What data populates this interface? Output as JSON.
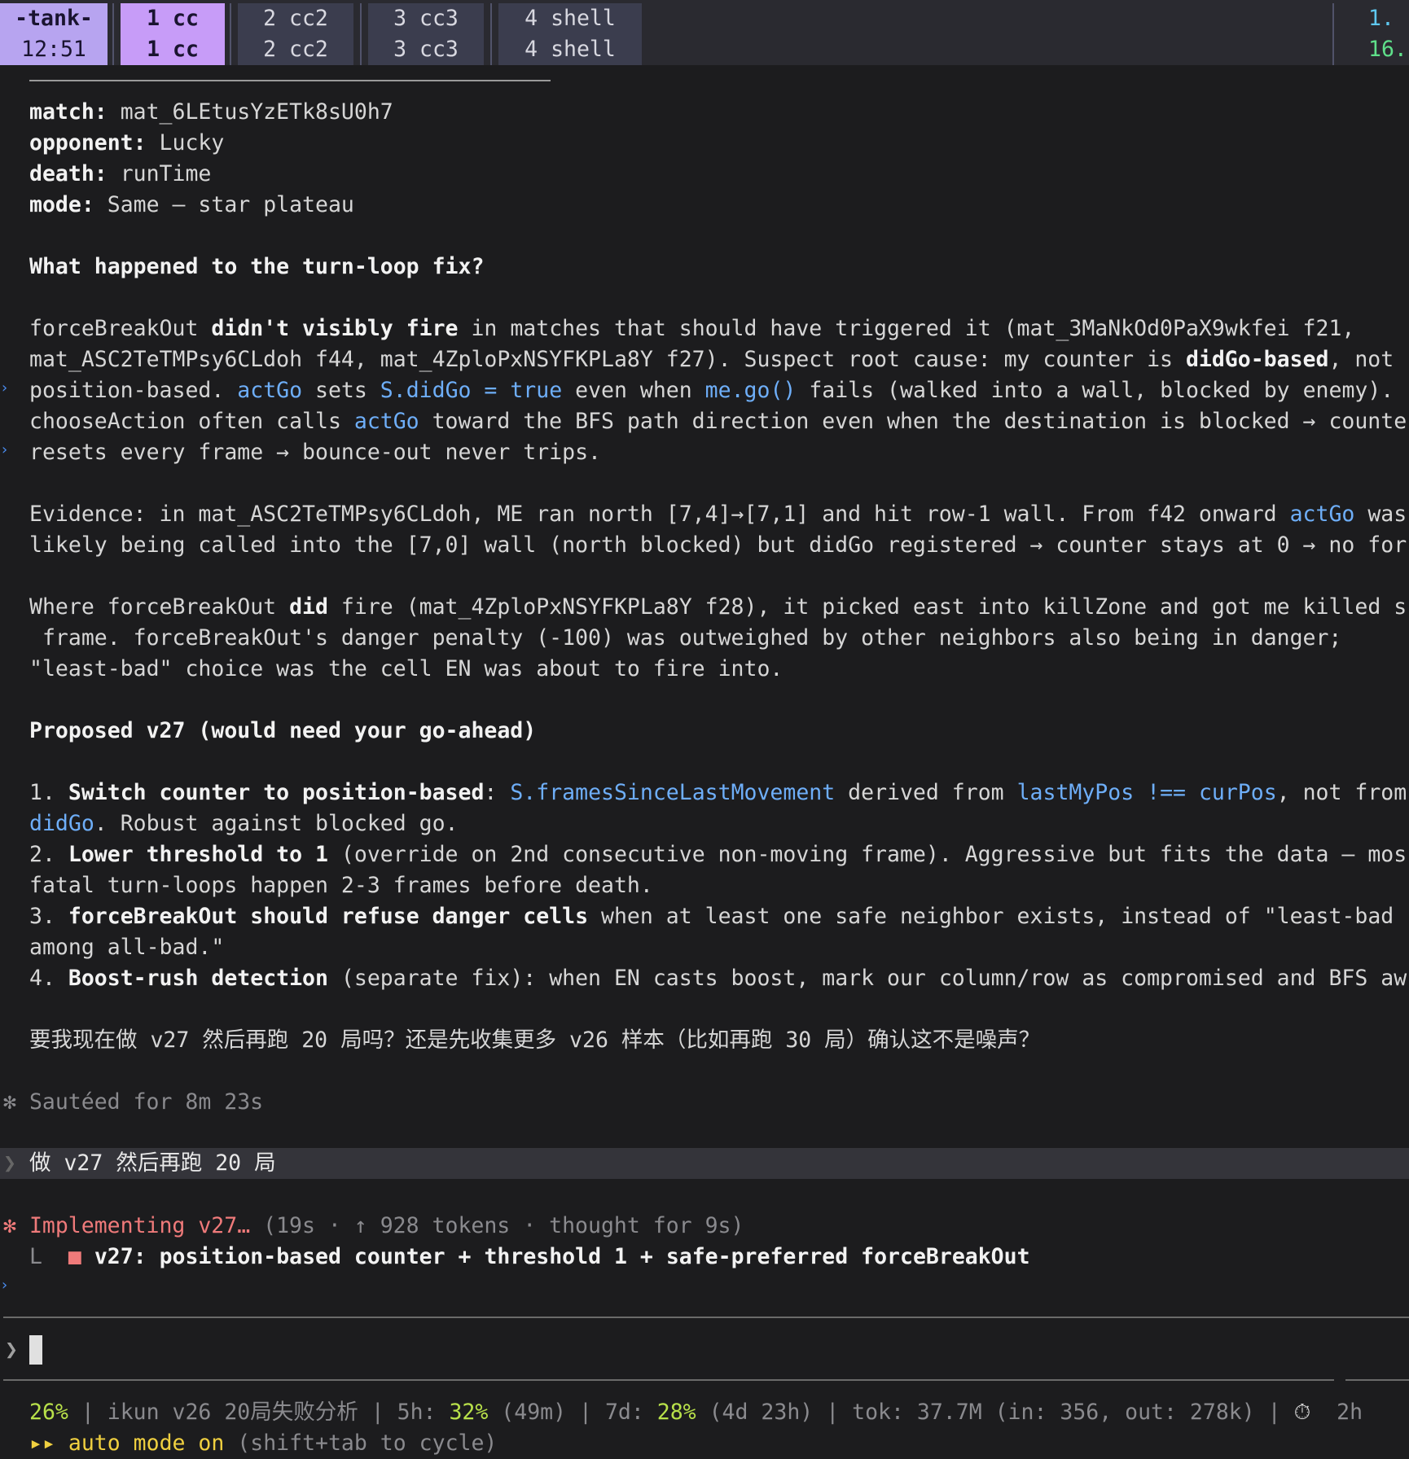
{
  "tabbar": {
    "session": {
      "name": "-tank-",
      "time": "12:51"
    },
    "tabs": [
      {
        "top": "1 cc",
        "bottom": "1 cc",
        "active": true
      },
      {
        "top": "2 cc2",
        "bottom": "2 cc2",
        "active": false
      },
      {
        "top": "3 cc3",
        "bottom": "3 cc3",
        "active": false
      },
      {
        "top": "4 shell",
        "bottom": "4 shell",
        "active": false
      }
    ],
    "right": {
      "top": "1.",
      "bottom": "16."
    }
  },
  "meta": {
    "match_label": "match:",
    "match_value": " mat_6LEtusYzETk8sU0h7",
    "opponent_label": "opponent:",
    "opponent_value": " Lucky",
    "death_label": "death:",
    "death_value": " runTime",
    "mode_label": "mode:",
    "mode_value": " Same — star plateau"
  },
  "section1": {
    "heading": "What happened to the turn-loop fix?",
    "p1": [
      [
        "forceBreakOut ",
        "b:didn't visibly fire",
        " in matches that should have triggered it (mat_3MaNkOd0PaX9wkfei f21,"
      ],
      [
        "mat_ASC2TeTMPsy6CLdoh f44, mat_4ZploPxNSYFKPLa8Y f27). Suspect root cause: my counter is ",
        "b:didGo-based",
        ", not"
      ],
      [
        "position-based. ",
        "c:actGo",
        " sets ",
        "c:S.didGo = true",
        " even when ",
        "c:me.go()",
        " fails (walked into a wall, blocked by enemy)."
      ],
      [
        "chooseAction often calls ",
        "c:actGo",
        " toward the BFS path direction even when the destination is blocked → counte"
      ],
      [
        "resets every frame → bounce-out never trips."
      ]
    ],
    "p2": [
      [
        "Evidence: in mat_ASC2TeTMPsy6CLdoh, ME ran north [7,4]→[7,1] and hit row-1 wall. From f42 onward ",
        "c:actGo",
        " was"
      ],
      [
        "likely being called into the [7,0] wall (north blocked) but didGo registered → counter stays at 0 → no for"
      ]
    ],
    "p3": [
      [
        "Where forceBreakOut ",
        "b:did",
        " fire (mat_4ZploPxNSYFKPLa8Y f28), it picked east into killZone and got me killed s"
      ],
      [
        " frame. forceBreakOut's danger penalty (-100) was outweighed by other neighbors also being in danger;"
      ],
      [
        "\"least-bad\" choice was the cell EN was about to fire into."
      ]
    ]
  },
  "section2": {
    "heading": "Proposed v27 (would need your go-ahead)",
    "items": [
      [
        "1. ",
        "b:Switch counter to position-based",
        ": ",
        "c:S.framesSinceLastMovement",
        " derived from ",
        "c:lastMyPos !== curPos",
        ", not from"
      ],
      [
        "c:didGo",
        ". Robust against blocked go."
      ],
      [
        "2. ",
        "b:Lower threshold to 1",
        " (override on 2nd consecutive non-moving frame). Aggressive but fits the data — mos"
      ],
      [
        "fatal turn-loops happen 2-3 frames before death."
      ],
      [
        "3. ",
        "b:forceBreakOut should refuse danger cells",
        " when at least one safe neighbor exists, instead of \"least-bad"
      ],
      [
        "among all-bad.\""
      ],
      [
        "4. ",
        "b:Boost-rush detection",
        " (separate fix): when EN casts boost, mark our column/row as compromised and BFS aw"
      ]
    ]
  },
  "question": "要我现在做 v27 然后再跑 20 局吗？还是先收集更多 v26 样本（比如再跑 30 局）确认这不是噪声？",
  "sauteed": {
    "star": "✻",
    "text": "Sautéed for 8m 23s"
  },
  "user_message": {
    "chevron": "❯",
    "text": "做 v27 然后再跑 20 局"
  },
  "working": {
    "star": "✻",
    "label": "Implementing v27…",
    "detail": " (19s · ↑ 928 tokens · thought for 9s)",
    "todo_prefix": "L",
    "todo_box": "■",
    "todo_text": "v27: position-based counter + threshold 1 + safe-preferred forceBreakOut"
  },
  "input": {
    "chevron": "❯",
    "value": ""
  },
  "statusline": {
    "pct": "26%",
    "sep": " | ",
    "project": "ikun v26 20局失败分析",
    "h5_label": "5h: ",
    "h5_pct": "32%",
    "h5_rest": " (49m)",
    "d7_label": "7d: ",
    "d7_pct": "28%",
    "d7_rest": " (4d 23h)",
    "tok": "tok: 37.7M (in: 356, out: 278k)",
    "timer_icon": "⏱",
    "timer": "2h",
    "mode_arrows": "▸▸",
    "mode_text": "auto mode on",
    "mode_hint": " (shift+tab to cycle)"
  },
  "colors": {
    "accent_tab": "#c79cf8",
    "code": "#6eaef8",
    "working": "#ef7a7a",
    "ok": "#b8e04a"
  }
}
